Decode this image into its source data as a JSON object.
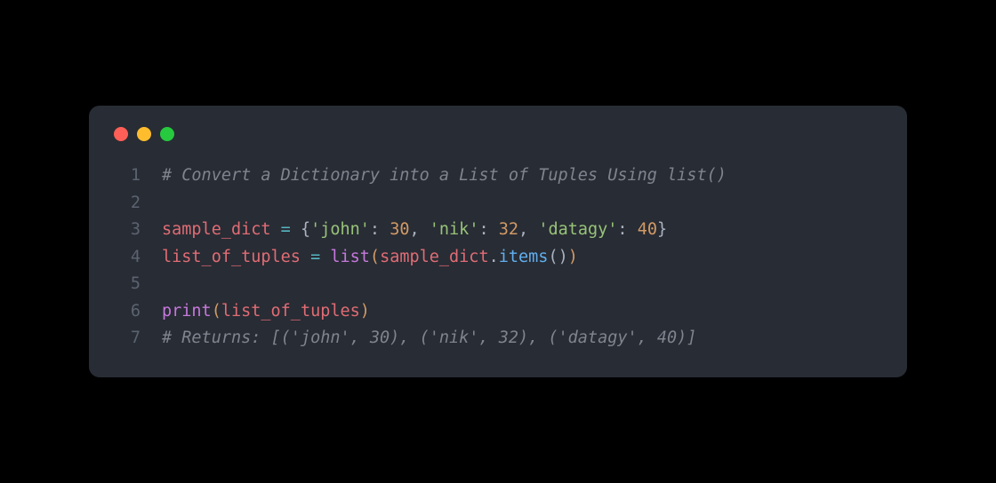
{
  "window": {
    "dots": [
      "red",
      "yellow",
      "green"
    ]
  },
  "code": {
    "lines": [
      {
        "num": "1",
        "tokens": [
          {
            "cls": "tok-comment",
            "text": "# Convert a Dictionary into a List of Tuples Using list()"
          }
        ]
      },
      {
        "num": "2",
        "tokens": []
      },
      {
        "num": "3",
        "tokens": [
          {
            "cls": "tok-variable",
            "text": "sample_dict"
          },
          {
            "cls": "tok-text",
            "text": " "
          },
          {
            "cls": "tok-operator",
            "text": "="
          },
          {
            "cls": "tok-text",
            "text": " {"
          },
          {
            "cls": "tok-string",
            "text": "'john'"
          },
          {
            "cls": "tok-text",
            "text": ": "
          },
          {
            "cls": "tok-number",
            "text": "30"
          },
          {
            "cls": "tok-text",
            "text": ", "
          },
          {
            "cls": "tok-string",
            "text": "'nik'"
          },
          {
            "cls": "tok-text",
            "text": ": "
          },
          {
            "cls": "tok-number",
            "text": "32"
          },
          {
            "cls": "tok-text",
            "text": ", "
          },
          {
            "cls": "tok-string",
            "text": "'datagy'"
          },
          {
            "cls": "tok-text",
            "text": ": "
          },
          {
            "cls": "tok-number",
            "text": "40"
          },
          {
            "cls": "tok-text",
            "text": "}"
          }
        ]
      },
      {
        "num": "4",
        "tokens": [
          {
            "cls": "tok-variable",
            "text": "list_of_tuples"
          },
          {
            "cls": "tok-text",
            "text": " "
          },
          {
            "cls": "tok-operator",
            "text": "="
          },
          {
            "cls": "tok-text",
            "text": " "
          },
          {
            "cls": "tok-builtin",
            "text": "list"
          },
          {
            "cls": "tok-paren",
            "text": "("
          },
          {
            "cls": "tok-variable",
            "text": "sample_dict"
          },
          {
            "cls": "tok-text",
            "text": "."
          },
          {
            "cls": "tok-function",
            "text": "items"
          },
          {
            "cls": "tok-text",
            "text": "()"
          },
          {
            "cls": "tok-paren",
            "text": ")"
          }
        ]
      },
      {
        "num": "5",
        "tokens": []
      },
      {
        "num": "6",
        "tokens": [
          {
            "cls": "tok-builtin",
            "text": "print"
          },
          {
            "cls": "tok-paren",
            "text": "("
          },
          {
            "cls": "tok-variable",
            "text": "list_of_tuples"
          },
          {
            "cls": "tok-paren",
            "text": ")"
          }
        ]
      },
      {
        "num": "7",
        "tokens": [
          {
            "cls": "tok-comment",
            "text": "# Returns: [('john', 30), ('nik', 32), ('datagy', 40)]"
          }
        ]
      }
    ]
  }
}
